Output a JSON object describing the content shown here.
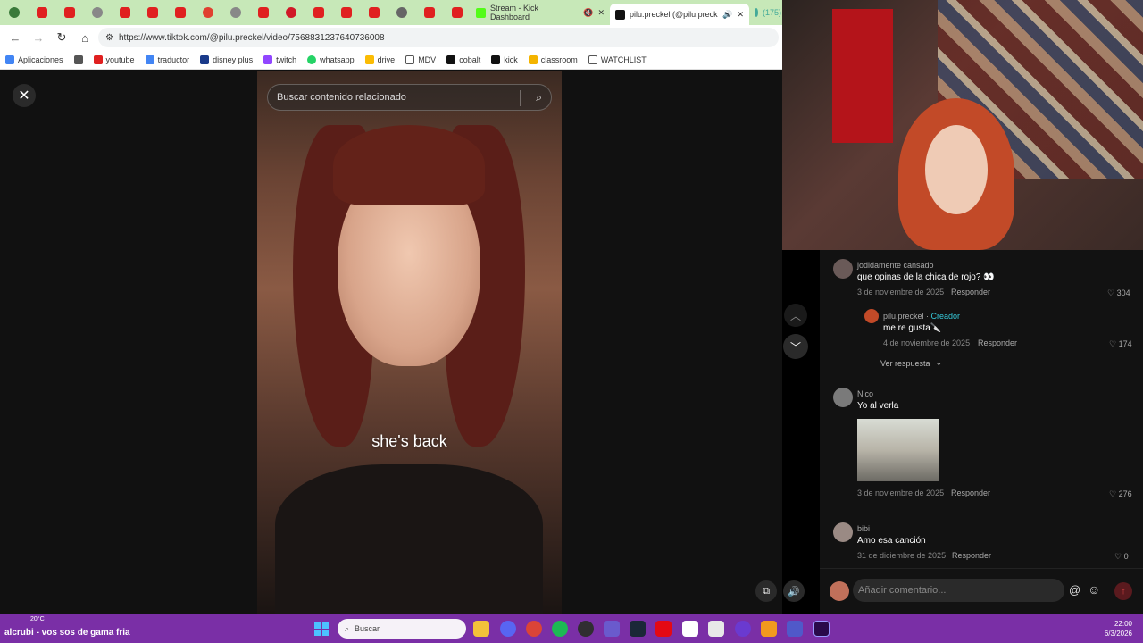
{
  "browser": {
    "tabs": [
      {
        "label": "Stream - Kick Dashboard",
        "active": false
      },
      {
        "label": "pilu.preckel (@pilu.preckel)",
        "active": true
      },
      {
        "label": "(175)",
        "active": false
      }
    ],
    "url": "https://www.tiktok.com/@pilu.preckel/video/7568831237640736008",
    "bookmarks": [
      "Aplicaciones",
      "youtube",
      "traductor",
      "disney plus",
      "twitch",
      "whatsapp",
      "drive",
      "MDV",
      "cobalt",
      "kick",
      "classroom",
      "WATCHLIST"
    ]
  },
  "video": {
    "search_placeholder": "Buscar contenido relacionado",
    "caption": "she's back"
  },
  "comments": [
    {
      "user": "jodidamente cansado",
      "text": "que opinas de la chica de rojo? 👀",
      "date": "3 de noviembre de 2025",
      "reply": "Responder",
      "likes": "304"
    },
    {
      "user": "pilu.preckel",
      "badge": "Creador",
      "text": "me re gusta🔪",
      "date": "4 de noviembre de 2025",
      "reply": "Responder",
      "likes": "174"
    },
    {
      "user": "Nico",
      "text": "Yo al verla",
      "date": "3 de noviembre de 2025",
      "reply": "Responder",
      "likes": "276"
    },
    {
      "user": "bibi",
      "text": "Amo esa canción",
      "date": "31 de diciembre de 2025",
      "reply": "Responder",
      "likes": "0"
    }
  ],
  "ver_respuesta": "Ver respuesta",
  "comment_input_placeholder": "Añadir comentario...",
  "taskbar": {
    "weather_temp": "20°C",
    "now_playing": "alcrubi - vos sos de gama fria",
    "search_label": "Buscar",
    "time": "22:00",
    "date": "6/3/2026"
  },
  "colors": {
    "tabbar": "#c7e8b8",
    "taskbar": "#7a2fa6",
    "creator_badge": "#36c9d9"
  }
}
